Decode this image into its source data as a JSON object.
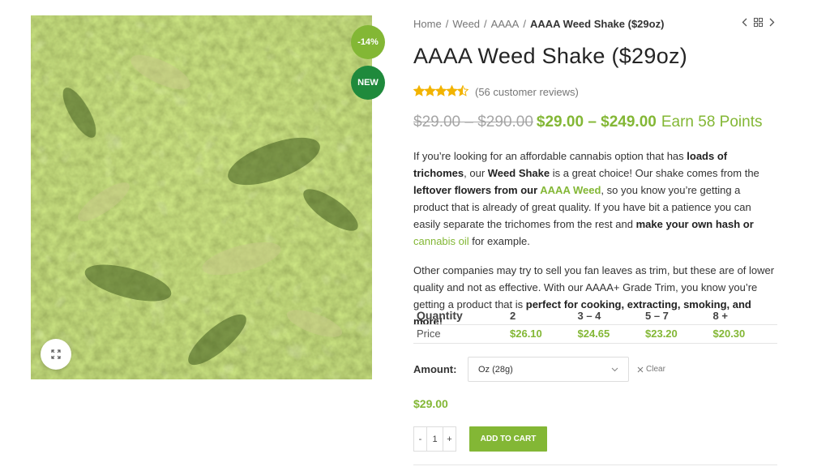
{
  "badges": {
    "sale": "-14%",
    "new": "NEW"
  },
  "breadcrumb": {
    "items": [
      "Home",
      "Weed",
      "AAAA"
    ],
    "current": "AAAA Weed Shake ($29oz)"
  },
  "product": {
    "title": "AAAA Weed Shake ($29oz)",
    "rating": 4.5,
    "reviews": "(56 customer reviews)",
    "price_old": "$29.00 – $290.00",
    "price_new": "$29.00 – $249.00",
    "points": "Earn 58 Points"
  },
  "description": {
    "p1": [
      {
        "t": "If you’re looking for an affordable cannabis option that has "
      },
      {
        "t": "loads of trichomes",
        "b": true
      },
      {
        "t": ", our "
      },
      {
        "t": "Weed Shake",
        "b": true
      },
      {
        "t": " is a great choice! Our shake comes from the "
      },
      {
        "t": "leftover flowers from our ",
        "b": true
      },
      {
        "t": "AAAA Weed",
        "link": true
      },
      {
        "t": ", so you know you’re getting a product that is already of great quality. If you have bit a patience you can easily separate the trichomes from the rest and "
      },
      {
        "t": "make your own hash or ",
        "b": true
      },
      {
        "t": "cannabis oil",
        "link": true
      },
      {
        "t": " for example."
      }
    ],
    "p2": [
      {
        "t": "Other companies may try to sell you fan leaves as trim, but these are of lower quality and not as effective. With our AAAA+ Grade Trim, you know you’re getting a product that is "
      },
      {
        "t": "perfect for cooking, extracting, smoking, and more!",
        "b": true
      }
    ]
  },
  "quantity_table": {
    "header": [
      "Quantity",
      "2",
      "3 – 4",
      "5 – 7",
      "8 +"
    ],
    "row_label": "Price",
    "prices": [
      "$26.10",
      "$24.65",
      "$23.20",
      "$20.30"
    ]
  },
  "amount": {
    "label": "Amount:",
    "selected": "Oz (28g)",
    "clear": "Clear"
  },
  "variation_price": "$29.00",
  "cart": {
    "minus": "-",
    "qty": "1",
    "plus": "+",
    "button": "ADD TO CART"
  },
  "icons": {
    "zoom": "expand-icon",
    "prev": "chevron-left-icon",
    "grid": "grid-icon",
    "next": "chevron-right-icon",
    "clear": "close-icon",
    "select": "chevron-down-icon"
  },
  "colors": {
    "accent": "#83b735",
    "new_badge": "#1f8a3c",
    "star": "#f2b300"
  }
}
